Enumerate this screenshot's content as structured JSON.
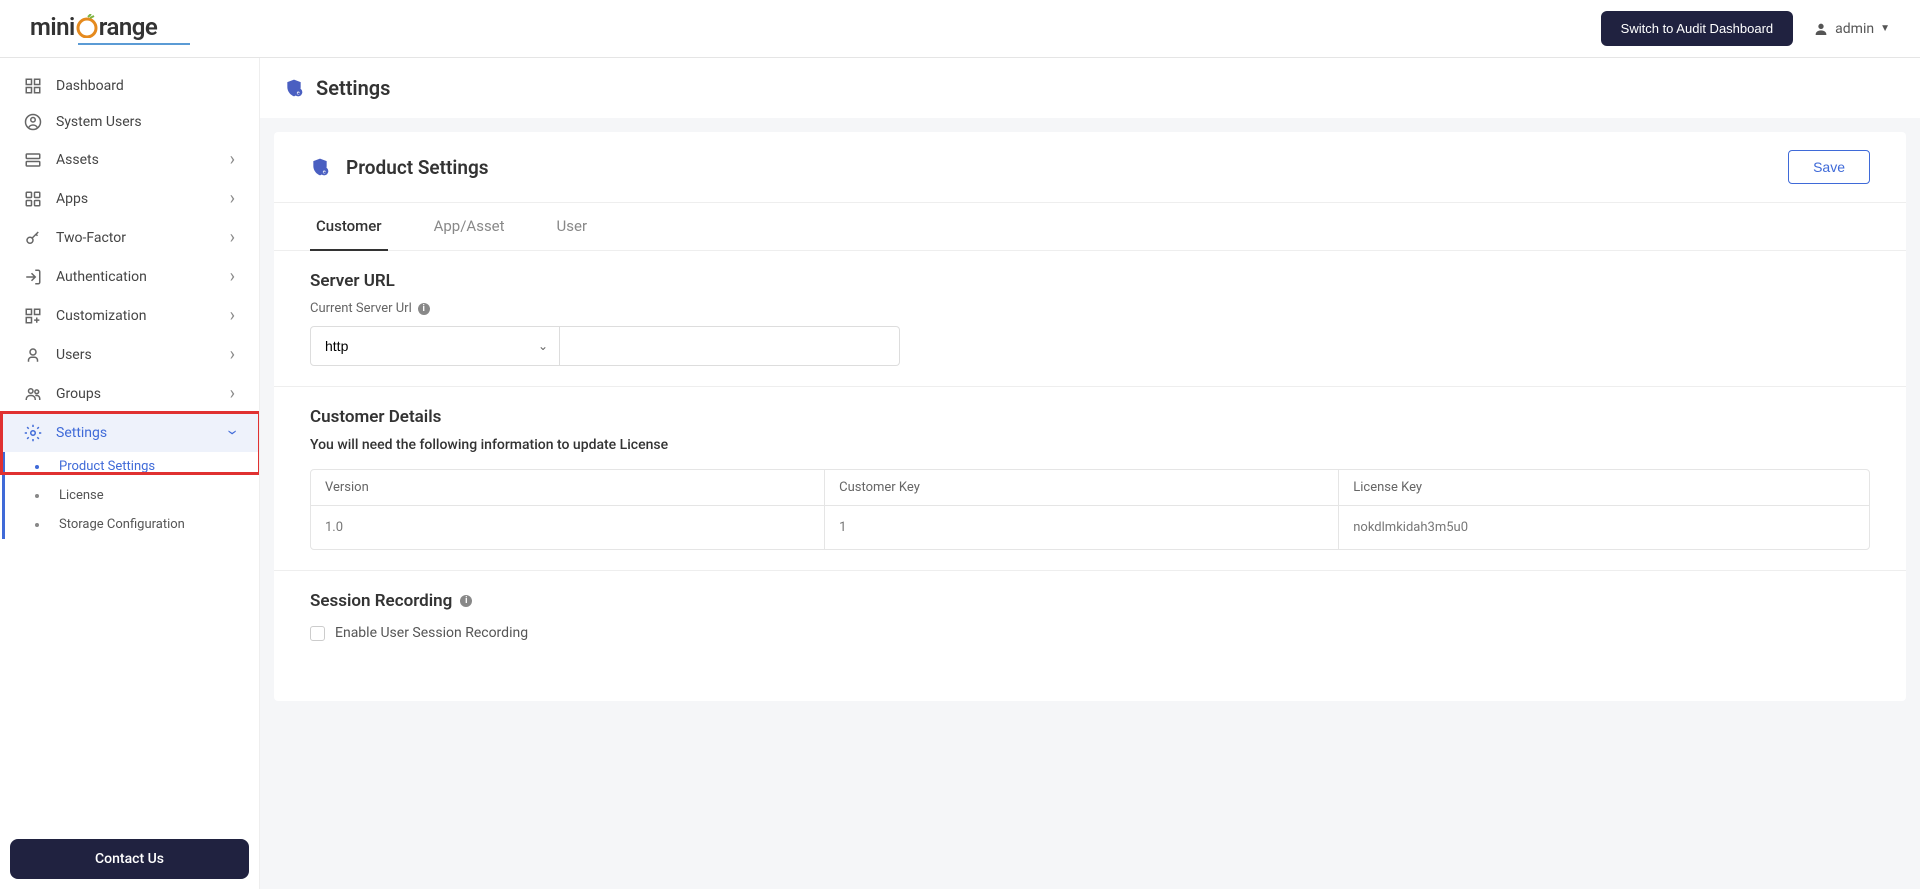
{
  "header": {
    "logo_text_1": "mini",
    "logo_text_2": "range",
    "audit_button": "Switch to Audit Dashboard",
    "username": "admin"
  },
  "sidebar": {
    "items": [
      {
        "label": "Dashboard",
        "icon": "dashboard"
      },
      {
        "label": "System Users",
        "icon": "user-circle"
      },
      {
        "label": "Assets",
        "icon": "server",
        "expandable": true
      },
      {
        "label": "Apps",
        "icon": "apps",
        "expandable": true
      },
      {
        "label": "Two-Factor",
        "icon": "key",
        "expandable": true
      },
      {
        "label": "Authentication",
        "icon": "login",
        "expandable": true
      },
      {
        "label": "Customization",
        "icon": "customize",
        "expandable": true
      },
      {
        "label": "Users",
        "icon": "user",
        "expandable": true
      },
      {
        "label": "Groups",
        "icon": "group",
        "expandable": true
      },
      {
        "label": "Settings",
        "icon": "gear",
        "expandable": true,
        "active": true
      }
    ],
    "sub_items": [
      {
        "label": "Product Settings",
        "active": true
      },
      {
        "label": "License"
      },
      {
        "label": "Storage Configuration"
      }
    ],
    "contact_button": "Contact Us"
  },
  "page": {
    "title": "Settings",
    "card_title": "Product Settings",
    "save_button": "Save"
  },
  "tabs": [
    {
      "label": "Customer",
      "active": true
    },
    {
      "label": "App/Asset"
    },
    {
      "label": "User"
    }
  ],
  "server_url": {
    "title": "Server URL",
    "label": "Current Server Url",
    "protocol": "http",
    "value": ""
  },
  "customer_details": {
    "title": "Customer Details",
    "note": "You will need the following information to update License",
    "columns": [
      "Version",
      "Customer Key",
      "License Key"
    ],
    "values": [
      "1.0",
      "1",
      "nokdlmkidah3m5u0"
    ]
  },
  "session_recording": {
    "title": "Session Recording",
    "checkbox_label": "Enable User Session Recording"
  }
}
